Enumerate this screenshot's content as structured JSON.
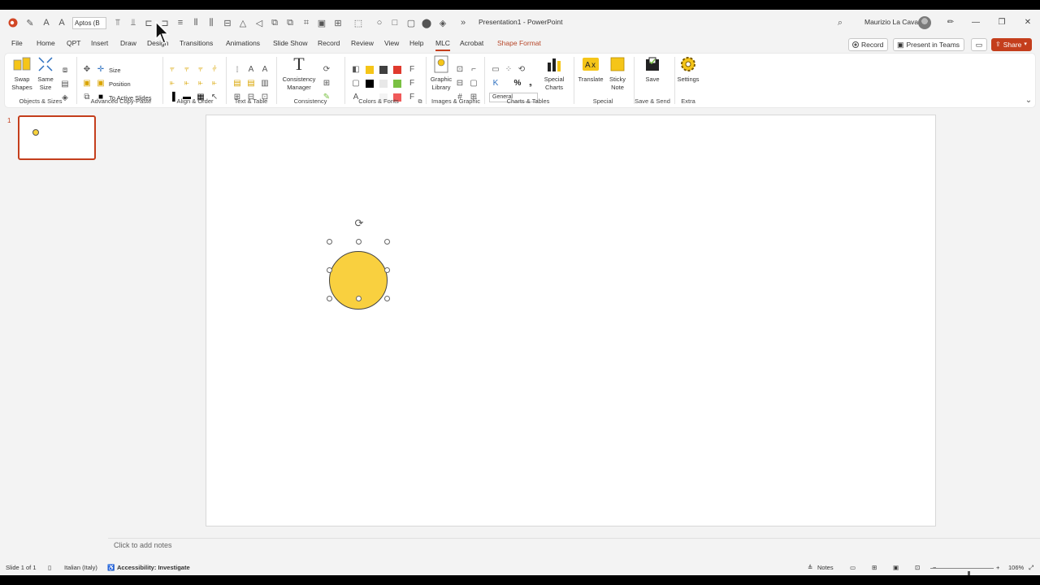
{
  "titlebar": {
    "font_box": "Aptos (B",
    "doc_title": "Presentation1 - PowerPoint",
    "user_name": "Maurizio La Cava",
    "overflow": "»"
  },
  "menu": {
    "tabs": [
      "File",
      "Home",
      "QPT",
      "Insert",
      "Draw",
      "Design",
      "Transitions",
      "Animations",
      "Slide Show",
      "Record",
      "Review",
      "View",
      "Help",
      "MLC",
      "Acrobat",
      "Shape Format"
    ],
    "active_tab": "MLC",
    "record_label": "Record",
    "present_label": "Present in Teams",
    "share_label": "Share"
  },
  "ribbon": {
    "groups": [
      "Objects & Sizes",
      "Advanced Copy-Paste",
      "Align & Order",
      "Text & Table",
      "Consistency",
      "Colors & Fonts",
      "Images & Graphic",
      "Charts & Tables",
      "Special",
      "Save & Send",
      "Extra"
    ],
    "swap_shapes": "Swap Shapes",
    "same_size": "Same Size",
    "size_label": "Size",
    "position_label": "Position",
    "to_active_slides": "To Active Slides",
    "consistency_manager": "Consistency Manager",
    "graphic_library": "Graphic Library",
    "general": "General",
    "special_charts": "Special Charts",
    "translate": "Translate",
    "sticky_note": "Sticky Note",
    "save": "Save",
    "settings": "Settings",
    "percent": "%"
  },
  "colors": {
    "accent": "#c43e1c",
    "shape_fill": "#f9d03f",
    "swatch_yellow": "#f5c518",
    "swatch_dark": "#404040",
    "swatch_red": "#e03a2e",
    "swatch_black": "#000000",
    "swatch_light": "#e8e8e8",
    "swatch_green": "#7ac143",
    "swatch_pink": "#f05a5a"
  },
  "thumbnails": [
    {
      "number": "1"
    }
  ],
  "notes_placeholder": "Click to add notes",
  "status": {
    "slide_info": "Slide 1 of 1",
    "language": "Italian (Italy)",
    "accessibility": "Accessibility: Investigate",
    "notes": "Notes",
    "zoom": "106%",
    "zoom_level": 0.6
  }
}
